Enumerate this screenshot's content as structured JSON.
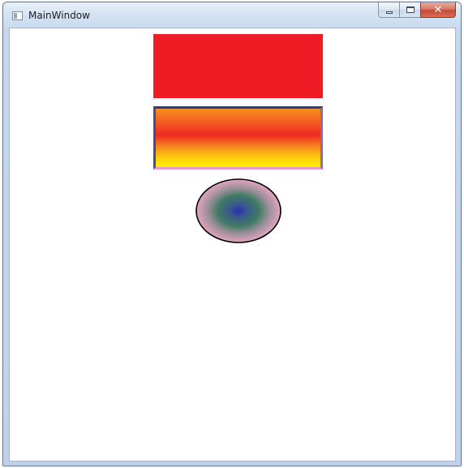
{
  "window": {
    "title": "MainWindow",
    "caption_buttons": {
      "minimize_icon": "minimize-icon",
      "maximize_icon": "maximize-icon",
      "close_icon": "close-icon",
      "close_glyph": "✕"
    }
  },
  "canvas": {
    "shapes": [
      {
        "kind": "rectangle",
        "fill": "#ef1c25",
        "stroke": null
      },
      {
        "kind": "rectangle",
        "fill": "linear-gradient",
        "gradient_stops": [
          "#f7901e",
          "#ee2a24",
          "#f6861f",
          "#fef200"
        ],
        "stroke_gradient": [
          "#2e3a8c",
          "#e39bc8"
        ]
      },
      {
        "kind": "ellipse",
        "fill": "radial-gradient",
        "gradient_stops": [
          "#2a2fb0",
          "#3e7a63",
          "#e3a4bf"
        ],
        "stroke": "#000000"
      }
    ]
  }
}
